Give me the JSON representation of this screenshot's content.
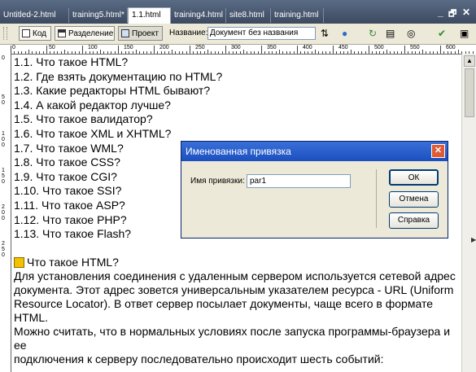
{
  "tabs": [
    "Untitled-2.html",
    "training5.html*",
    "1.1.html",
    "training4.html",
    "site8.html",
    "training.html"
  ],
  "active_tab": 2,
  "window_controls": {
    "minimize": "_",
    "restore": "🗗",
    "close": "✕"
  },
  "toolbar": {
    "code_label": "Код",
    "split_label": "Разделение",
    "design_label": "Проект",
    "title_label": "Название:",
    "title_value": "Документ без названия"
  },
  "ruler_top_labels": [
    "0",
    "50",
    "100",
    "150",
    "200",
    "250",
    "300",
    "350",
    "400",
    "450",
    "500",
    "550",
    "600"
  ],
  "ruler_left_labels": [
    "0",
    "5\n0",
    "1\n0\n0",
    "1\n5\n0",
    "2\n0\n0",
    "2\n5\n0"
  ],
  "toc": [
    "1.1. Что такое HTML?",
    "1.2. Где взять документацию по HTML?",
    "1.3. Какие редакторы HTML бывают?",
    "1.4. А какой редактор лучше?",
    "1.5. Что такое валидатор?",
    "1.6. Что такое XML и XHTML?",
    "1.7. Что такое WML?",
    "1.8. Что такое CSS?",
    "1.9. Что такое CGI?",
    "1.10. Что такое SSI?",
    "1.11. Что такое ASP?",
    "1.12. Что такое PHP?",
    "1.13. Что такое Flash?"
  ],
  "section_heading": "Что такое HTML?",
  "paragraphs": [
    "Для установления соединения с удаленным сервером используется сетевой адрес документа. Этот адрес зовется универсальным указателем ресурса - URL (Uniform Resource Locator). В ответ сервер посылает документы, чаще всего в формате HTML.",
    "Можно считать, что в нормальных условиях после запуска программы-браузера и ее",
    "подключения к серверу последовательно происходит шесть событий:"
  ],
  "dialog": {
    "title": "Именованная привязка",
    "field_label": "Имя привязки:",
    "field_value": "par1",
    "ok_label": "ОК",
    "cancel_label": "Отмена",
    "help_label": "Справка"
  }
}
